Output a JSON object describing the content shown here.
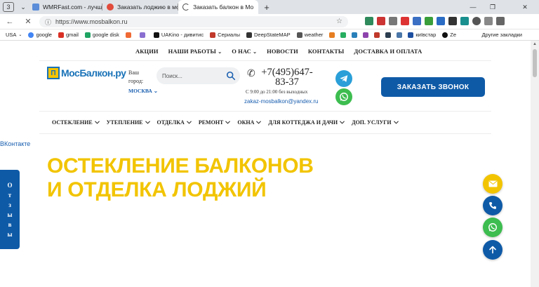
{
  "browser": {
    "tab_count": "3",
    "tabs": [
      {
        "title": "WMRFast.com - лучшее м",
        "favicon_color": "#5b8dd9"
      },
      {
        "title": "Заказать лоджию в моск",
        "favicon_color": "#e14b3b"
      },
      {
        "title": "Заказать балкон в Мо",
        "favicon_color": "#cccccc",
        "active": true
      }
    ],
    "url": "https://www.mosbalkon.ru",
    "bookmarks": [
      "USA",
      "google",
      "gmail",
      "google disk",
      "",
      "",
      "UAKino - дивитис",
      "Сериалы",
      "DeepStateMAP",
      "weather",
      "",
      "",
      "",
      "",
      "",
      "",
      "",
      "київстар",
      "Ze"
    ],
    "other_bookmarks": "Другие закладки"
  },
  "site": {
    "top_nav": [
      "АКЦИИ",
      "НАШИ РАБОТЫ",
      "О НАС",
      "НОВОСТИ",
      "КОНТАКТЫ",
      "ДОСТАВКА И ОПЛАТА"
    ],
    "top_nav_dropdown": [
      false,
      true,
      true,
      false,
      false,
      false
    ],
    "logo_text": "МосБалкон.ру",
    "city_label": "Ваш город:",
    "city_value": "МОСКВА",
    "search_placeholder": "Поиск...",
    "phone": "+7(495)647-83-37",
    "hours": "С 9:00 до 21:00 без выходных",
    "email": "zakaz-mosbalkon@yandex.ru",
    "call_button": "ЗАКАЗАТЬ ЗВОНОК",
    "main_nav": [
      "ОСТЕКЛЕНИЕ",
      "УТЕПЛЕНИЕ",
      "ОТДЕЛКА",
      "РЕМОНТ",
      "ОКНА",
      "ДЛЯ КОТТЕДЖА И ДАЧИ",
      "ДОП. УСЛУГИ"
    ],
    "vk_label": "ВКонтакте",
    "hero_line1": "ОСТЕКЛЕНИЕ БАЛКОНОВ",
    "hero_line2": "И ОТДЕЛКА ЛОДЖИЙ",
    "reviews_letters": [
      "О",
      "т",
      "з",
      "ы",
      "в",
      "ы"
    ]
  },
  "colors": {
    "brand_blue": "#0e5aa7",
    "brand_yellow": "#f2c400",
    "telegram": "#2a9fd8",
    "whatsapp": "#3dbd4f"
  },
  "icons": [
    "telegram-icon",
    "whatsapp-icon",
    "mail-icon",
    "phone-icon",
    "arrow-up-icon",
    "search-icon"
  ]
}
